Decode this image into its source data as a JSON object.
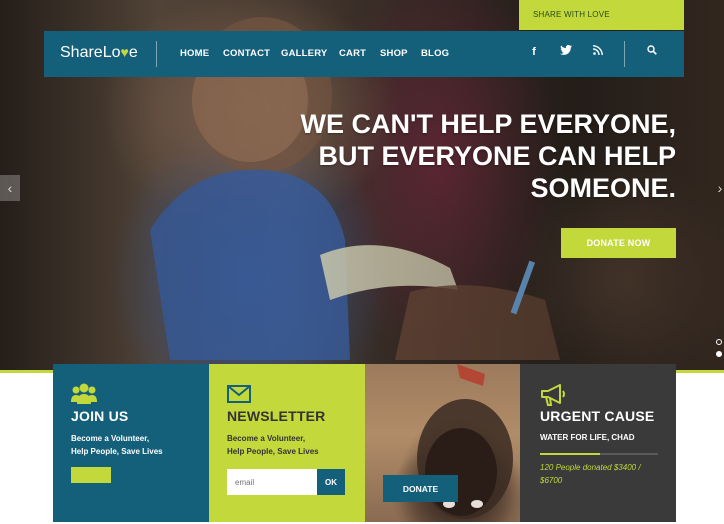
{
  "topbar": {
    "label": "SHARE WITH LOVE"
  },
  "brand": {
    "logo_prefix": "ShareLo",
    "logo_heart": "♥",
    "logo_suffix": "e"
  },
  "nav": {
    "items": [
      "HOME",
      "CONTACT",
      "GALLERY",
      "CART",
      "SHOP",
      "BLOG"
    ],
    "icons": [
      "facebook-icon",
      "twitter-icon",
      "rss-icon",
      "search-icon"
    ]
  },
  "hero": {
    "headline_line1": "WE CAN'T HELP EVERYONE,",
    "headline_line2": "BUT EVERYONE CAN HELP",
    "headline_line3": "SOMEONE.",
    "cta_label": "DONATE NOW"
  },
  "cards": {
    "join": {
      "title": "JOIN US",
      "line1": "Become a Volunteer,",
      "line2": "Help People, Save Lives"
    },
    "newsletter": {
      "title": "NEWSLETTER",
      "line1": "Become a Volunteer,",
      "line2": "Help People, Save Lives",
      "email_placeholder": "email",
      "ok_label": "OK"
    },
    "photo": {
      "donate_label": "DONATE"
    },
    "urgent": {
      "title": "URGENT CAUSE",
      "subtitle": "WATER FOR LIFE, CHAD",
      "donated_text": "120 People donated $3400 / $6700",
      "progress_fraction": 0.507
    }
  },
  "colors": {
    "accent": "#c2d83b",
    "primary": "#14607b",
    "dark": "#3a3a3a"
  }
}
